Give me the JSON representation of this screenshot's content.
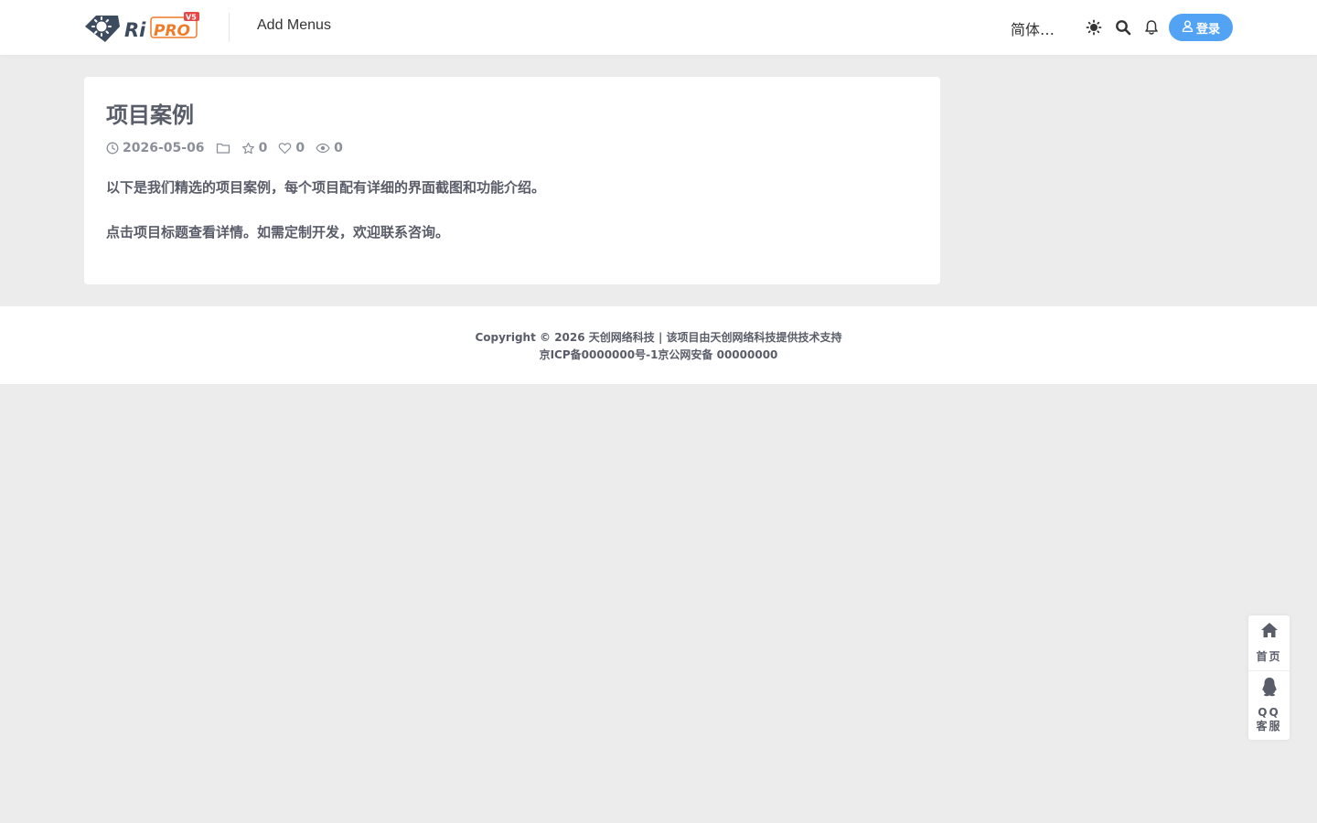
{
  "header": {
    "logo_text": "RiPRO",
    "logo_badge": "V5",
    "nav_item": "Add Menus",
    "language": "简体…",
    "login_label": "登录",
    "accent": "#53a3f5"
  },
  "icons": {
    "theme": "theme-toggle-icon",
    "search": "search-icon",
    "notify": "bell-icon",
    "user": "user-icon",
    "clock": "clock-icon",
    "folder": "folder-icon",
    "star": "star-icon",
    "heart": "heart-icon",
    "eye": "eye-icon",
    "home": "home-icon",
    "qq": "qq-icon"
  },
  "article": {
    "title": "项目案例",
    "date": "2026-05-06",
    "stars": "0",
    "likes": "0",
    "views": "0",
    "paragraphs": [
      "以下是我们精选的项目案例，每个项目配有详细的界面截图和功能介绍。",
      "点击项目标题查看详情。如需定制开发，欢迎联系咨询。"
    ]
  },
  "footer": {
    "copyright": "Copyright © 2026 天创网络科技 | 该项目由天创网络科技提供技术支持",
    "icp": "京ICP备0000000号-1京公网安备 00000000"
  },
  "float_bar": {
    "home_label": "首页",
    "qq_label_1": "QQ",
    "qq_label_2": "客服"
  }
}
